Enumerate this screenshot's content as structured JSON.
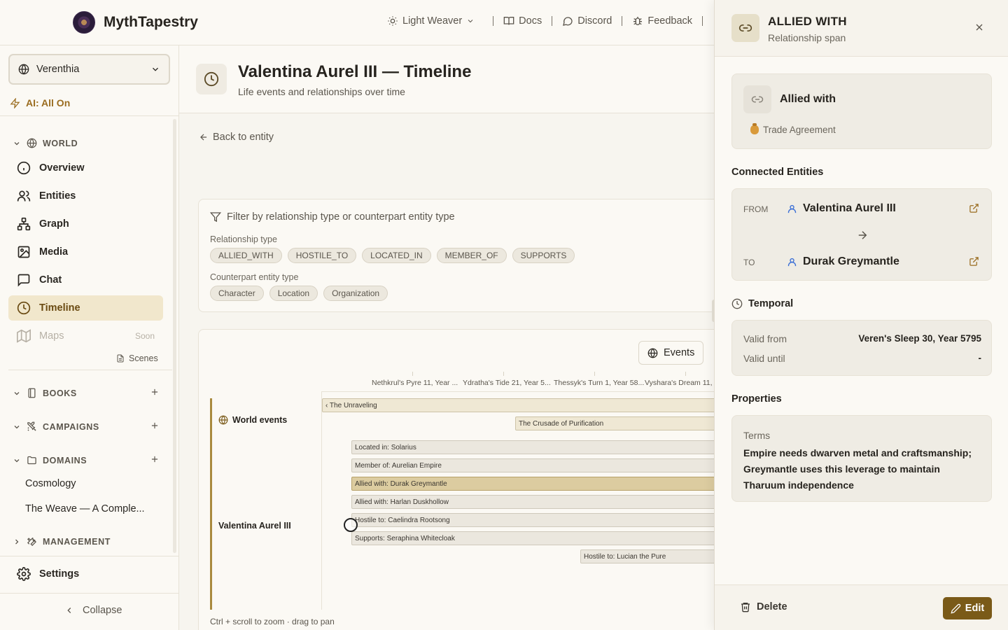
{
  "app": {
    "name": "MythTapestry"
  },
  "topnav": {
    "theme": "Light Weaver",
    "docs": "Docs",
    "discord": "Discord",
    "feedback": "Feedback"
  },
  "sidebar": {
    "world": "Verenthia",
    "ai_status": "AI: All On",
    "sections": {
      "world": "WORLD",
      "books": "BOOKS",
      "campaigns": "CAMPAIGNS",
      "domains": "DOMAINS",
      "management": "MANAGEMENT"
    },
    "items": [
      {
        "label": "Overview",
        "icon": "info-icon"
      },
      {
        "label": "Entities",
        "icon": "users-icon"
      },
      {
        "label": "Graph",
        "icon": "graph-icon"
      },
      {
        "label": "Media",
        "icon": "image-icon"
      },
      {
        "label": "Chat",
        "icon": "chat-icon"
      },
      {
        "label": "Timeline",
        "icon": "clock-icon",
        "active": true
      },
      {
        "label": "Maps",
        "icon": "map-icon",
        "disabled": true,
        "badge": "Soon"
      }
    ],
    "scenes": "Scenes",
    "domains": [
      "Cosmology",
      "The Weave — A Comple..."
    ],
    "settings": "Settings",
    "collapse": "Collapse"
  },
  "page": {
    "title": "Valentina Aurel III — Timeline",
    "subtitle": "Life events and relationships over time",
    "back": "Back to entity"
  },
  "filters": {
    "heading": "Filter by relationship type or counterpart entity type",
    "rel_label": "Relationship type",
    "rel_types": [
      "ALLIED_WITH",
      "HOSTILE_TO",
      "LOCATED_IN",
      "MEMBER_OF",
      "SUPPORTS"
    ],
    "entity_label": "Counterpart entity type",
    "entity_types": [
      "Character",
      "Location",
      "Organization"
    ]
  },
  "timeline": {
    "events_button": "Events",
    "axis_labels": [
      "Nethkrul's Pyre 11, Year ...",
      "Ydratha's Tide 21, Year 5...",
      "Thessyk's Turn 1, Year 58...",
      "Vyshara's Dream 11, Ye"
    ],
    "lanes": {
      "world": "World events",
      "entity": "Valentina Aurel III"
    },
    "world_events": [
      "‹ The Unraveling",
      "The Crusade of Purification"
    ],
    "relationships": [
      "Located in: Solarius",
      "Member of: Aurelian Empire",
      "Allied with: Durak Greymantle",
      "Allied with: Harlan Duskhollow",
      "Hostile to: Caelindra Rootsong",
      "Supports: Seraphina Whitecloak",
      "Hostile to: Lucian the Pure"
    ],
    "hint": "Ctrl + scroll to zoom · drag to pan"
  },
  "panel": {
    "title": "ALLIED WITH",
    "subtitle": "Relationship span",
    "rel_name": "Allied with",
    "rel_meta": "Trade Agreement",
    "connected_heading": "Connected Entities",
    "from_label": "FROM",
    "from_name": "Valentina Aurel III",
    "to_label": "TO",
    "to_name": "Durak Greymantle",
    "temporal_heading": "Temporal",
    "valid_from_label": "Valid from",
    "valid_from": "Veren's Sleep 30, Year 5795",
    "valid_until_label": "Valid until",
    "valid_until": "-",
    "properties_heading": "Properties",
    "terms_label": "Terms",
    "terms_value": "Empire needs dwarven metal and craftsmanship; Greymantle uses this leverage to maintain Tharuum independence",
    "delete": "Delete",
    "edit": "Edit"
  },
  "colors": {
    "accent": "#7a5a18",
    "active_bg": "#f1e7cc",
    "ai_status": "#9a6c1f",
    "entity_icon": "#3b6fd6"
  }
}
